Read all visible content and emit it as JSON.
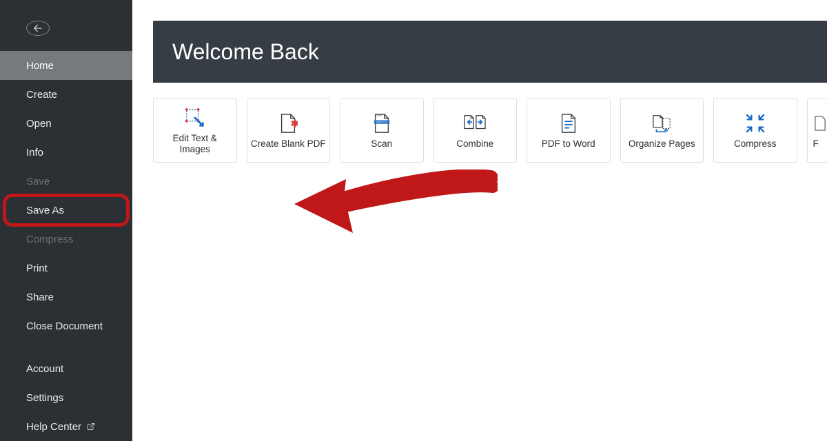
{
  "sidebar": {
    "items": [
      {
        "label": "Home",
        "state": "selected"
      },
      {
        "label": "Create",
        "state": ""
      },
      {
        "label": "Open",
        "state": ""
      },
      {
        "label": "Info",
        "state": ""
      },
      {
        "label": "Save",
        "state": "disabled"
      },
      {
        "label": "Save As",
        "state": "highlighted"
      },
      {
        "label": "Compress",
        "state": "disabled"
      },
      {
        "label": "Print",
        "state": ""
      },
      {
        "label": "Share",
        "state": ""
      },
      {
        "label": "Close Document",
        "state": ""
      }
    ],
    "footer": [
      {
        "label": "Account"
      },
      {
        "label": "Settings"
      },
      {
        "label": "Help Center",
        "external": true
      }
    ]
  },
  "header": {
    "title": "Welcome Back"
  },
  "cards": [
    {
      "label": "Edit Text & Images",
      "icon": "edit-text-images"
    },
    {
      "label": "Create Blank PDF",
      "icon": "create-blank-pdf"
    },
    {
      "label": "Scan",
      "icon": "scan"
    },
    {
      "label": "Combine",
      "icon": "combine"
    },
    {
      "label": "PDF to Word",
      "icon": "pdf-to-word"
    },
    {
      "label": "Organize Pages",
      "icon": "organize-pages"
    },
    {
      "label": "Compress",
      "icon": "compress"
    },
    {
      "label": "F",
      "icon": "partial"
    }
  ],
  "annotation": {
    "type": "arrow",
    "color": "#c01818",
    "target": "Save As"
  }
}
